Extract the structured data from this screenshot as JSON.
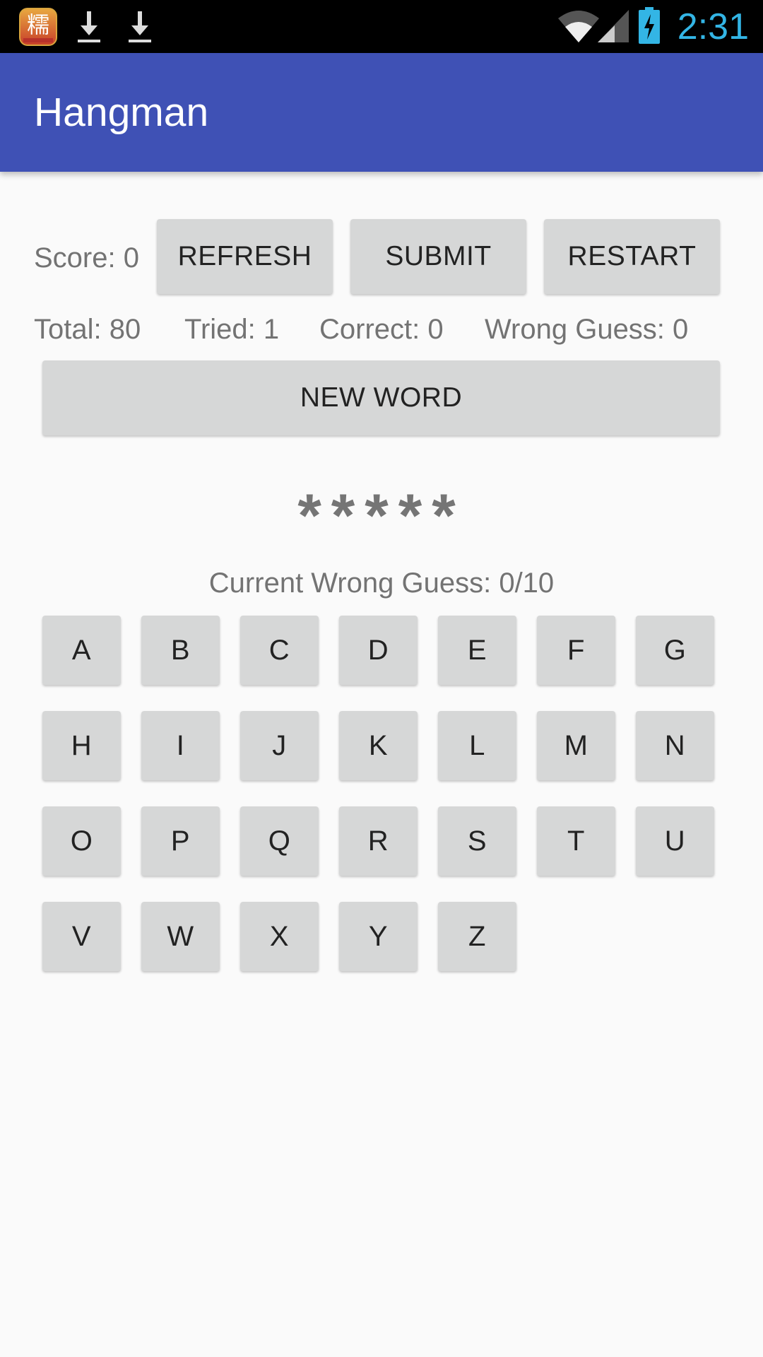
{
  "status_bar": {
    "app_icon_glyph": "糯",
    "icons": [
      "app-notification-icon",
      "download-icon",
      "download-icon",
      "wifi-icon",
      "cell-signal-icon",
      "battery-charging-icon"
    ],
    "clock": "2:31",
    "clock_color": "#33b5e5"
  },
  "app_bar": {
    "title": "Hangman",
    "color": "#3f51b5"
  },
  "controls": {
    "score_label": "Score: 0",
    "refresh_label": "REFRESH",
    "submit_label": "SUBMIT",
    "restart_label": "RESTART"
  },
  "stats": {
    "total": "Total: 80",
    "tried": "Tried: 1",
    "correct": "Correct: 0",
    "wrong": "Wrong Guess: 0"
  },
  "new_word_label": "NEW WORD",
  "masked_word": "*****",
  "current_wrong_guess": "Current Wrong Guess: 0/10",
  "keyboard": {
    "letters": [
      "A",
      "B",
      "C",
      "D",
      "E",
      "F",
      "G",
      "H",
      "I",
      "J",
      "K",
      "L",
      "M",
      "N",
      "O",
      "P",
      "Q",
      "R",
      "S",
      "T",
      "U",
      "V",
      "W",
      "X",
      "Y",
      "Z"
    ]
  }
}
